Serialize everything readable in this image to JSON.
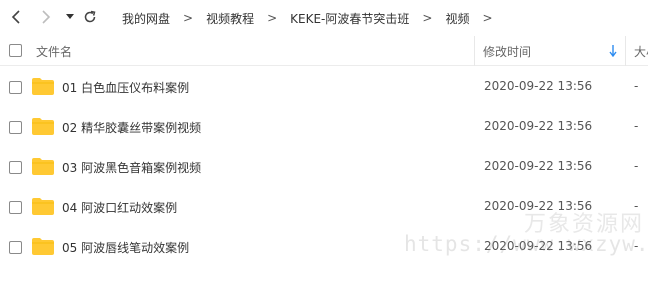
{
  "breadcrumb": [
    "我的网盘",
    "视频教程",
    "KEKE-阿波春节突击班",
    "视频"
  ],
  "columns": {
    "name": "文件名",
    "modified": "修改时间",
    "size": "大小"
  },
  "files": [
    {
      "name": "01 白色血压仪布料案例",
      "modified": "2020-09-22 13:56",
      "size": "-"
    },
    {
      "name": "02 精华胶囊丝带案例视频",
      "modified": "2020-09-22 13:56",
      "size": "-"
    },
    {
      "name": "03 阿波黑色音箱案例视频",
      "modified": "2020-09-22 13:56",
      "size": "-"
    },
    {
      "name": "04 阿波口红动效案例",
      "modified": "2020-09-22 13:56",
      "size": "-"
    },
    {
      "name": "05 阿波唇线笔动效案例",
      "modified": "2020-09-22 13:56",
      "size": "-"
    }
  ],
  "sort": {
    "column": "modified",
    "direction": "descending",
    "icon": "arrow-down-icon",
    "color": "#2d8cf0"
  },
  "icons": {
    "back": "chevron-left-icon",
    "forward": "chevron-right-icon",
    "history": "caret-down-icon",
    "refresh": "refresh-icon",
    "folder": "folder-icon"
  },
  "colors": {
    "folder": "#ffc933",
    "accent": "#2d8cf0"
  },
  "watermark": {
    "title": "万象资源网",
    "url": "https://www.wxzyw.cn"
  }
}
